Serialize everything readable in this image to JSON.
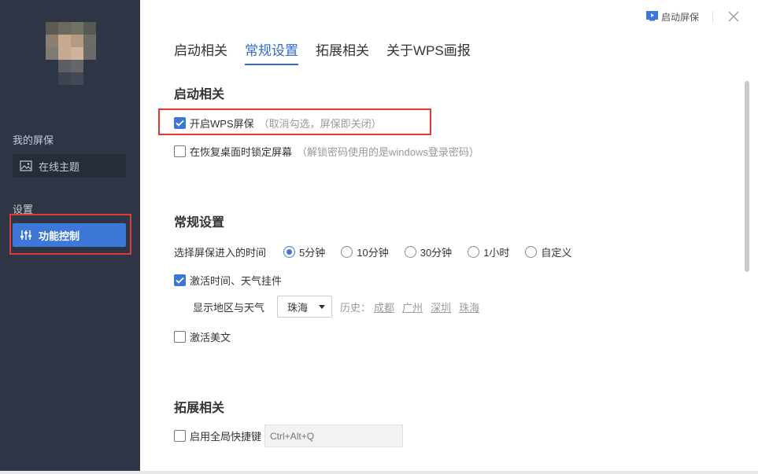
{
  "sidebar": {
    "my_screensaver_label": "我的屏保",
    "online_theme_label": "在线主题",
    "settings_label": "设置",
    "function_control_label": "功能控制"
  },
  "topbar": {
    "launch_label": "启动屏保"
  },
  "tabs": [
    {
      "label": "启动相关"
    },
    {
      "label": "常规设置"
    },
    {
      "label": "拓展相关"
    },
    {
      "label": "关于WPS画报"
    }
  ],
  "startup": {
    "title": "启动相关",
    "enable_label": "开启WPS屏保",
    "enable_hint": "（取消勾选，屏保即关闭）",
    "enable_checked": true,
    "lock_label": "在恢复桌面时锁定屏幕",
    "lock_hint": "（解锁密码使用的是windows登录密码）",
    "lock_checked": false
  },
  "general": {
    "title": "常规设置",
    "time_label": "选择屏保进入的时间",
    "time_options": [
      "5分钟",
      "10分钟",
      "30分钟",
      "1小时",
      "自定义"
    ],
    "time_selected": "5分钟",
    "widget_label": "激活时间、天气挂件",
    "widget_checked": true,
    "region_label": "显示地区与天气",
    "region_selected": "珠海",
    "history_label": "历史：",
    "history": [
      "成都",
      "广州",
      "深圳",
      "珠海"
    ],
    "article_label": "激活美文",
    "article_checked": false
  },
  "extension": {
    "title": "拓展相关",
    "hotkey_label": "启用全局快捷键",
    "hotkey_checked": false,
    "hotkey_placeholder": "Ctrl+Alt+Q"
  },
  "colors": {
    "sidebar_bg": "#2e3545",
    "accent": "#3d78d8",
    "highlight_box": "#e53935"
  }
}
